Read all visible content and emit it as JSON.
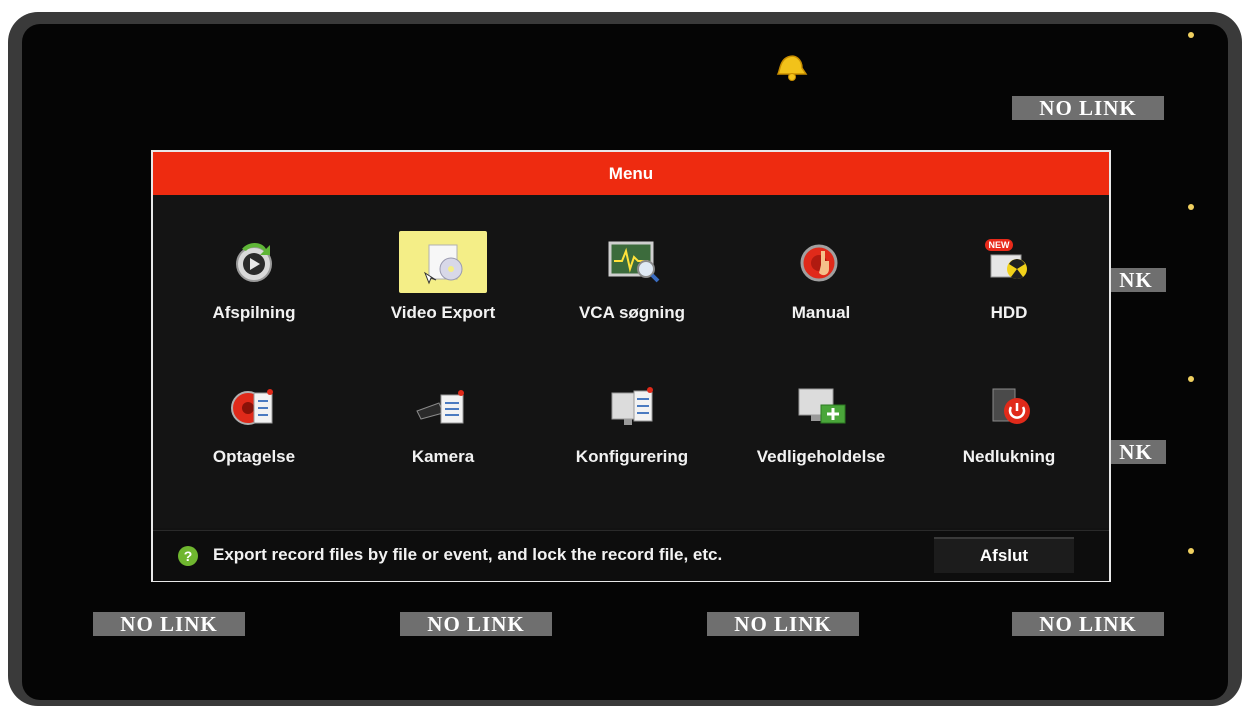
{
  "status": {
    "no_link": "NO LINK",
    "clipped_no_link": "NK"
  },
  "menu": {
    "title": "Menu",
    "items": [
      {
        "label": "Afspilning",
        "icon": "playback-icon"
      },
      {
        "label": "Video Export",
        "icon": "video-export-icon",
        "selected": true
      },
      {
        "label": "VCA søgning",
        "icon": "vca-search-icon"
      },
      {
        "label": "Manual",
        "icon": "manual-record-icon"
      },
      {
        "label": "HDD",
        "icon": "hdd-icon",
        "badge": "NEW"
      },
      {
        "label": "Optagelse",
        "icon": "record-schedule-icon"
      },
      {
        "label": "Kamera",
        "icon": "camera-settings-icon"
      },
      {
        "label": "Konfigurering",
        "icon": "configuration-icon"
      },
      {
        "label": "Vedligeholdelse",
        "icon": "maintenance-icon"
      },
      {
        "label": "Nedlukning",
        "icon": "shutdown-icon"
      }
    ],
    "help_text": "Export record files by file or event, and lock the record file, etc.",
    "exit_label": "Afslut"
  },
  "colors": {
    "title_bar": "#ee2b10",
    "selected_tile": "#f4ee87",
    "help_icon": "#6fb62f"
  }
}
